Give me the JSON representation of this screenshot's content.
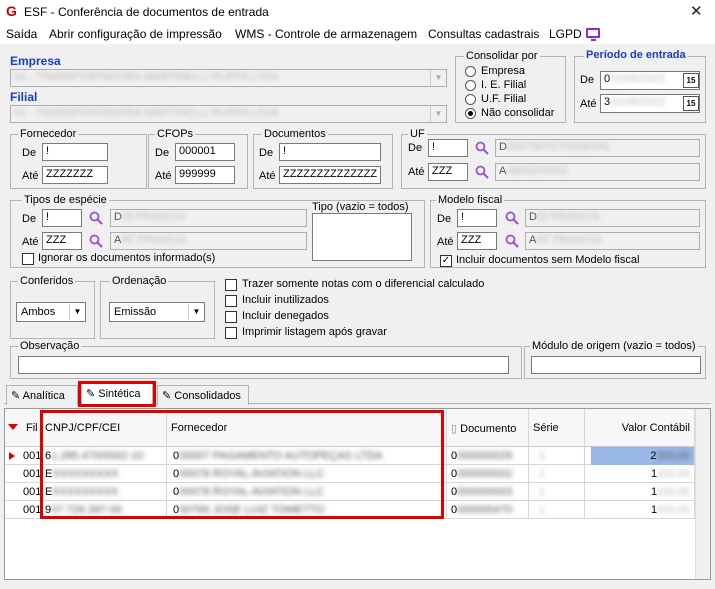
{
  "window": {
    "title": "ESF - Conferência de documentos de entrada",
    "close": "✕",
    "logo": "G"
  },
  "menu": [
    "Saída",
    "Abrir configuração de impressão",
    "WMS - Controle de armazenagem",
    "Consultas cadastrais",
    "LGPD"
  ],
  "empresa": {
    "label": "Empresa",
    "value": "01 - TRANSPORTADORA MARTINELLI RUPPA LTDA"
  },
  "filial": {
    "label": "Filial",
    "value": "01 - TRANSPORTADORA MARTINELLI RUPPA LTDA"
  },
  "consolidar": {
    "title": "Consolidar por",
    "options": [
      "Empresa",
      "I. E. Filial",
      "U.F. Filial",
      "Não consolidar"
    ],
    "selected": 3
  },
  "periodo": {
    "title": "Período de entrada",
    "de_label": "De",
    "de_value": "01/08/2022",
    "ate_label": "Até",
    "ate_value": "31/08/2022",
    "cal": "15"
  },
  "fornecedor": {
    "title": "Fornecedor",
    "de_label": "De",
    "de": "!",
    "ate_label": "Até",
    "ate": "ZZZZZZZ"
  },
  "cfops": {
    "title": "CFOPs",
    "de_label": "De",
    "de": "000001",
    "ate_label": "Até",
    "ate": "999999"
  },
  "documentos": {
    "title": "Documentos",
    "de_label": "De",
    "de": "!",
    "ate_label": "Até",
    "ate": "ZZZZZZZZZZZZZZ"
  },
  "uf": {
    "title": "UF",
    "de_label": "De",
    "de": "!",
    "de_desc": "DISTRITO FEDERAL",
    "ate_label": "Até",
    "ate": "ZZZ",
    "ate_desc": "AMAZONAS"
  },
  "especie": {
    "title": "Tipos de espécie",
    "de_label": "De",
    "de": "!",
    "de_desc": "DI PRANCIS",
    "ate_label": "Até",
    "ate": "ZZZ",
    "ate_desc": "AT PRANCIS",
    "ignorar": "Ignorar os documentos informado(s)"
  },
  "tipo": {
    "title": "Tipo (vazio = todos)"
  },
  "modelo": {
    "title": "Modelo fiscal",
    "de_label": "De",
    "de": "!",
    "de_desc": "DI PRANCIS",
    "ate_label": "Até",
    "ate": "ZZZ",
    "ate_desc": "AT PRANCIS",
    "incluir": "Incluir documentos sem Modelo fiscal"
  },
  "conferidos": {
    "title": "Conferidos",
    "value": "Ambos"
  },
  "ordenacao": {
    "title": "Ordenação",
    "value": "Emissão"
  },
  "checks": [
    "Trazer somente notas com o diferencial calculado",
    "Incluir inutilizados",
    "Incluir denegados",
    "Imprimir listagem após gravar"
  ],
  "observacao": {
    "title": "Observação"
  },
  "modulo": {
    "title": "Módulo de origem (vazio = todos)"
  },
  "tabs": [
    "Analítica",
    "Sintética",
    "Consolidados"
  ],
  "grid": {
    "headers": [
      "Fil",
      "CNPJ/CPF/CEI",
      "Fornecedor",
      "Documento",
      "Série",
      "Valor Contábil"
    ],
    "rows": [
      {
        "fil": "001",
        "cnpj_first": "6",
        "cnpj": "1.285.470/0002-10",
        "forn_first": "0",
        "forn": "00007 PAGAMENTO AUTOPEÇAS LTDA",
        "doc_first": "0",
        "doc": "000000029",
        "serie": "1",
        "val_first": "2",
        "val": "200,00"
      },
      {
        "fil": "001",
        "cnpj_first": "E",
        "cnpj": "XXXXXXXXX",
        "forn_first": "0",
        "forn": "00078 ROYAL AVIATION LLC",
        "doc_first": "0",
        "doc": "000000002",
        "serie": "1",
        "val_first": "1",
        "val": "100,00"
      },
      {
        "fil": "001",
        "cnpj_first": "E",
        "cnpj": "XXXXXXXXX",
        "forn_first": "0",
        "forn": "00078 ROYAL AVIATION LLC",
        "doc_first": "0",
        "doc": "000000003",
        "serie": "1",
        "val_first": "1",
        "val": "100,00"
      },
      {
        "fil": "001",
        "cnpj_first": "9",
        "cnpj": "07.726.397-00",
        "forn_first": "0",
        "forn": "00766 JOSE LUIZ TOMETTO",
        "doc_first": "0",
        "doc": "000000470",
        "serie": "1",
        "val_first": "1",
        "val": "100,00"
      }
    ]
  }
}
